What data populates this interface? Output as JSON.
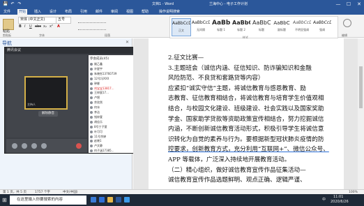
{
  "window": {
    "doc_name": "文档1 - Word",
    "app_label": "兰海中心 - 电子工作计划",
    "controls": {
      "minimize": "—",
      "maximize": "☐",
      "close": "✕"
    }
  },
  "quick_access": [
    "💾",
    "↶",
    "↷"
  ],
  "tabs": [
    {
      "label": "文件",
      "active": false
    },
    {
      "label": "开始",
      "active": true
    },
    {
      "label": "插入",
      "active": false
    },
    {
      "label": "设计",
      "active": false
    },
    {
      "label": "布局",
      "active": false
    },
    {
      "label": "引用",
      "active": false
    },
    {
      "label": "邮件",
      "active": false
    },
    {
      "label": "审阅",
      "active": false
    },
    {
      "label": "视图",
      "active": false
    },
    {
      "label": "帮助",
      "active": false
    },
    {
      "label": "操作说明搜索",
      "active": false
    }
  ],
  "ribbon": {
    "paste_label": "粘贴",
    "font_name": "宋体 (中文正文)",
    "font_size": "五号",
    "format_buttons": [
      "B",
      "I",
      "U",
      "abc",
      "x₂",
      "x²",
      "A"
    ],
    "group_labels": {
      "clipboard": "剪贴板",
      "font": "字体",
      "paragraph": "段落",
      "styles": "样式",
      "editing": "编辑"
    },
    "styles": [
      {
        "preview": "AaBbCcDc",
        "name": "正文",
        "selected": true
      },
      {
        "preview": "AaBbCcDc",
        "name": "无间隔",
        "selected": false
      },
      {
        "preview": "AaBb",
        "name": "标题 1",
        "selected": false
      },
      {
        "preview": "AaBbC",
        "name": "标题 2",
        "selected": false
      },
      {
        "preview": "AaBbC",
        "name": "标题",
        "selected": false
      },
      {
        "preview": "AaBbC",
        "name": "副标题",
        "selected": false
      },
      {
        "preview": "AaBbCcDc",
        "name": "不明显强调",
        "selected": false
      },
      {
        "preview": "AaBbCcDc",
        "name": "强调",
        "selected": false
      }
    ]
  },
  "nav": {
    "title": "导航",
    "close": "✕"
  },
  "meeting": {
    "title": "腾讯会议",
    "video_label": "主持人",
    "button": "解除静音",
    "list_header": "参会成员(45)",
    "participants": [
      {
        "name": "姚乙鑫",
        "highlight": false
      },
      {
        "name": "许星宇",
        "highlight": false
      },
      {
        "name": "朱晓彤13760739",
        "highlight": false
      },
      {
        "name": "12号冯XXX",
        "highlight": false
      },
      {
        "name": "钟娜",
        "highlight": false
      },
      {
        "name": "刘宝宝13817...",
        "highlight": true
      },
      {
        "name": "王梓宸17...",
        "highlight": false
      },
      {
        "name": "卢煜",
        "highlight": false
      },
      {
        "name": "余欣然",
        "highlight": false
      },
      {
        "name": "何冰",
        "highlight": false
      },
      {
        "name": "李洁",
        "highlight": false
      },
      {
        "name": "钱梓萱",
        "highlight": false
      },
      {
        "name": "胡佳乐",
        "highlight": false
      },
      {
        "name": "8号丁子萱",
        "highlight": false
      },
      {
        "name": "叶可可",
        "highlight": false
      },
      {
        "name": "11号余婷",
        "highlight": false
      },
      {
        "name": "赵晓1",
        "highlight": false
      },
      {
        "name": "卢文静",
        "highlight": false
      },
      {
        "name": "何子涵17385...",
        "highlight": false
      }
    ]
  },
  "document": {
    "lines": [
      {
        "text": "2.征文比赛—",
        "underline": false
      },
      {
        "text": "3.主题班会（诚信内涵、征信知识、防诈骗知识和金融",
        "underline": false
      },
      {
        "text": "风险防范、不良贷和套路贷等内容）",
        "underline": false
      },
      {
        "text": "    应紧扣“诚实守信”主题，将诚信教育与感恩教育、励",
        "underline": false
      },
      {
        "text": "志教育、征信教育相结合，将诚信教育与培育学生价值观相",
        "underline": false
      },
      {
        "text": "结合，与校园文化建设、班级建设、社会实践以及国家奖助",
        "underline": false
      },
      {
        "text": "学金、国家助学贷款等资助政策宣传相结合，努力挖掘诚信",
        "underline": false
      },
      {
        "text": "内涵，不断创新诚信教育活动形式，积极引导学生将诚信意",
        "underline": false
      },
      {
        "text": "识转化为自觉的素养与行为。要根据新型冠状肺炎疫情的防",
        "underline": false
      },
      {
        "text": "控要求，创新教育方式，充分利用“互联网+”、微信公众号、",
        "underline": true
      },
      {
        "text": "APP 等载体，广泛深入持续地开展教育活动。",
        "underline": false
      },
      {
        "text": "    （二）精心组织，做好诚信教育宣传作品征集活动—",
        "underline": false
      },
      {
        "text": "    诚信教育宣传作品选题鲜明、观点正确、逻辑严谨、",
        "underline": false
      }
    ]
  },
  "status": {
    "page": "第 1 页，共 5 页",
    "words": "1757 个字",
    "lang": "中文(中国)",
    "zoom": "100%"
  },
  "taskbar": {
    "start": "⊞",
    "search_placeholder": "在这里输入你要搜索的内容",
    "time": "11:01",
    "date": "2020/6/26",
    "tray_lang": "中"
  }
}
